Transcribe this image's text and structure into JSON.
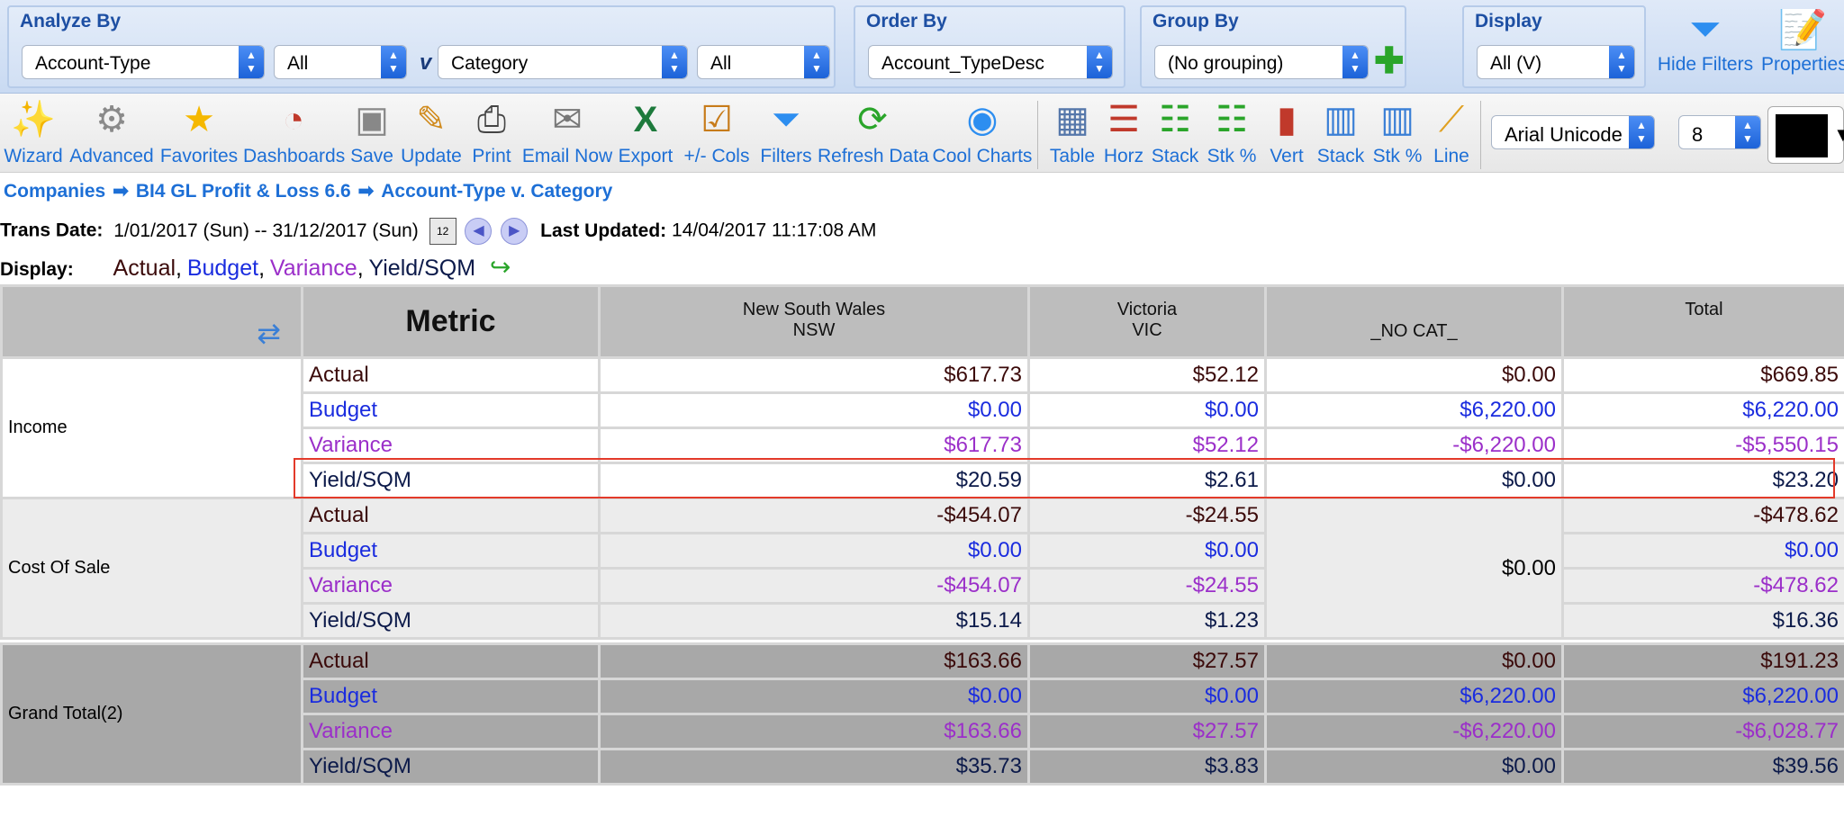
{
  "filters": {
    "analyze_by": {
      "title": "Analyze By",
      "field1": "Account-Type",
      "field1_value": "All",
      "versus": "v",
      "field2": "Category",
      "field2_value": "All"
    },
    "order_by": {
      "title": "Order By",
      "value": "Account_TypeDesc"
    },
    "group_by": {
      "title": "Group By",
      "value": "(No grouping)"
    },
    "display": {
      "title": "Display",
      "value": "All (V)"
    },
    "hide_filters_label": "Hide Filters",
    "properties_label": "Properties"
  },
  "toolbar": {
    "buttons": [
      {
        "label": "Wizard",
        "icon": "wizard-icon"
      },
      {
        "label": "Advanced",
        "icon": "gear-icon"
      },
      {
        "label": "Favorites",
        "icon": "star-icon"
      },
      {
        "label": "Dashboards",
        "icon": "dashboard-icon"
      },
      {
        "label": "Save",
        "icon": "floppy-icon"
      },
      {
        "label": "Update",
        "icon": "edit-icon"
      },
      {
        "label": "Print",
        "icon": "printer-icon"
      },
      {
        "label": "Email Now",
        "icon": "email-icon"
      },
      {
        "label": "Export",
        "icon": "excel-icon"
      },
      {
        "label": "+/- Cols",
        "icon": "columns-icon"
      },
      {
        "label": "Filters",
        "icon": "funnel-icon"
      },
      {
        "label": "Refresh Data",
        "icon": "refresh-icon"
      },
      {
        "label": "Cool Charts",
        "icon": "cool-charts-icon"
      },
      {
        "label": "Table",
        "icon": "table-icon"
      },
      {
        "label": "Horz",
        "icon": "horizontal-bar-icon"
      },
      {
        "label": "Stack",
        "icon": "stacked-horizontal-icon"
      },
      {
        "label": "Stk %",
        "icon": "stacked-percent-horizontal-icon"
      },
      {
        "label": "Vert",
        "icon": "vertical-bar-icon"
      },
      {
        "label": "Stack",
        "icon": "stacked-vertical-icon"
      },
      {
        "label": "Stk %",
        "icon": "stacked-percent-vertical-icon"
      },
      {
        "label": "Line",
        "icon": "line-chart-icon"
      }
    ],
    "font_family": "Arial Unicode",
    "font_size": "8",
    "color_value": "#000000"
  },
  "breadcrumb": [
    "Companies",
    "BI4 GL Profit & Loss 6.6",
    "Account-Type v. Category"
  ],
  "trans": {
    "label": "Trans Date:",
    "range": "1/01/2017 (Sun) -- 31/12/2017 (Sun)",
    "calendar_glyph": "12",
    "updated_label": "Last Updated:",
    "updated_value": "14/04/2017 11:17:08 AM"
  },
  "display_line": {
    "label": "Display:",
    "actual": "Actual",
    "budget": "Budget",
    "variance": "Variance",
    "yield": "Yield/SQM",
    "sep": ","
  },
  "table": {
    "header": {
      "metric": "Metric",
      "cols": [
        {
          "line1": "New South Wales",
          "line2": "NSW"
        },
        {
          "line1": "Victoria",
          "line2": "VIC"
        },
        {
          "line1": "",
          "line2": "_NO CAT_"
        },
        {
          "line1": "Total",
          "line2": ""
        }
      ]
    },
    "groups": [
      {
        "label": "Income",
        "rows": [
          {
            "metric": "Actual",
            "vals": [
              "$617.73",
              "$52.12",
              "$0.00",
              "$669.85"
            ]
          },
          {
            "metric": "Budget",
            "vals": [
              "$0.00",
              "$0.00",
              "$6,220.00",
              "$6,220.00"
            ]
          },
          {
            "metric": "Variance",
            "vals": [
              "$617.73",
              "$52.12",
              "-$6,220.00",
              "-$5,550.15"
            ]
          },
          {
            "metric": "Yield/SQM",
            "vals": [
              "$20.59",
              "$2.61",
              "$0.00",
              "$23.20"
            ]
          }
        ]
      },
      {
        "label": "Cost Of Sale",
        "nocat_merged": "$0.00",
        "rows": [
          {
            "metric": "Actual",
            "vals": [
              "-$454.07",
              "-$24.55",
              "",
              "-$478.62"
            ]
          },
          {
            "metric": "Budget",
            "vals": [
              "$0.00",
              "$0.00",
              "",
              "$0.00"
            ]
          },
          {
            "metric": "Variance",
            "vals": [
              "-$454.07",
              "-$24.55",
              "",
              "-$478.62"
            ]
          },
          {
            "metric": "Yield/SQM",
            "vals": [
              "$15.14",
              "$1.23",
              "",
              "$16.36"
            ]
          }
        ]
      },
      {
        "label": "Grand Total(2)",
        "rows": [
          {
            "metric": "Actual",
            "vals": [
              "$163.66",
              "$27.57",
              "$0.00",
              "$191.23"
            ]
          },
          {
            "metric": "Budget",
            "vals": [
              "$0.00",
              "$0.00",
              "$6,220.00",
              "$6,220.00"
            ]
          },
          {
            "metric": "Variance",
            "vals": [
              "$163.66",
              "$27.57",
              "-$6,220.00",
              "-$6,028.77"
            ]
          },
          {
            "metric": "Yield/SQM",
            "vals": [
              "$35.73",
              "$3.83",
              "$0.00",
              "$39.56"
            ]
          }
        ]
      }
    ]
  }
}
